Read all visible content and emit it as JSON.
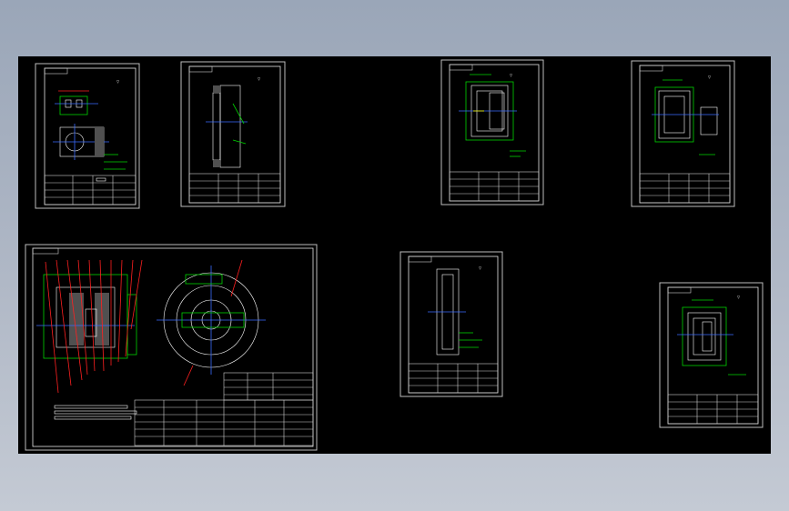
{
  "app": {
    "background_top": "#9aa6b8",
    "canvas_color": "#000000",
    "accent_green": "#00d400",
    "accent_red": "#ff2020",
    "accent_blue": "#3a6cff"
  },
  "icons": [
    "surface-finish-icon"
  ]
}
